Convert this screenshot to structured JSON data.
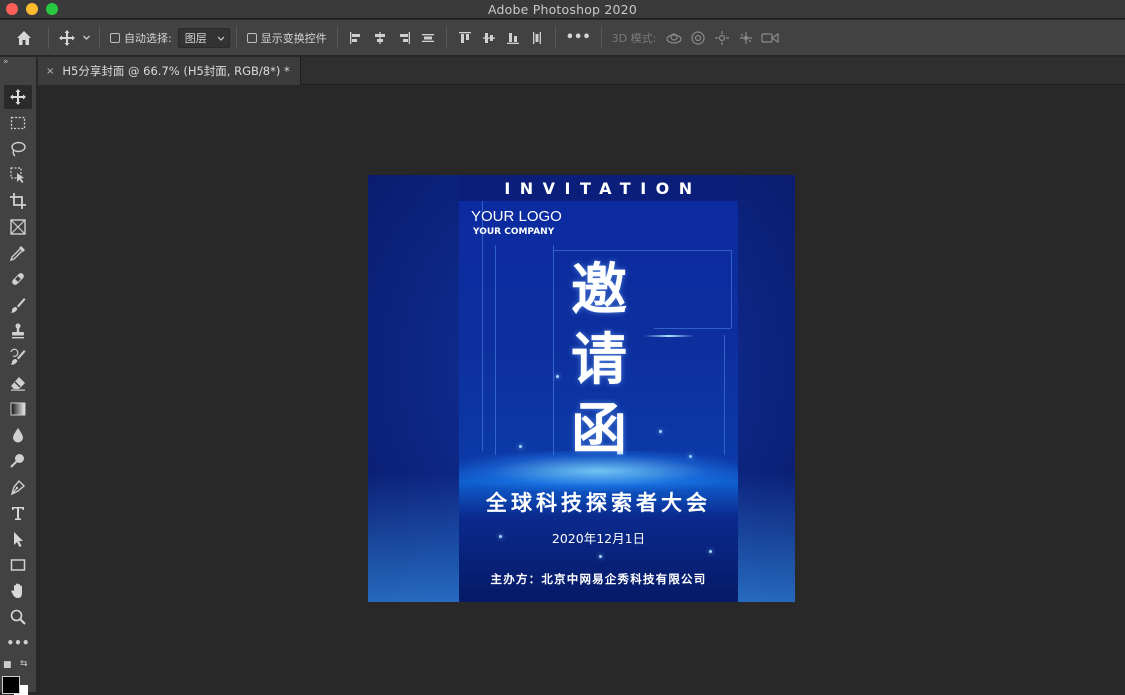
{
  "window": {
    "title": "Adobe Photoshop 2020"
  },
  "options_bar": {
    "auto_select_label": "自动选择:",
    "auto_select_value": "图层",
    "show_transform_label": "显示变换控件",
    "more_label": "•••",
    "mode_3d_label": "3D 模式:"
  },
  "tabs": [
    {
      "label": "H5分享封面 @ 66.7% (H5封面, RGB/8*) *",
      "close": "×"
    }
  ],
  "toolbar": {
    "collapse": "»",
    "more": "•••",
    "tools": [
      "move-tool",
      "marquee-tool",
      "lasso-tool",
      "object-select-tool",
      "crop-tool",
      "frame-tool",
      "eyedropper-tool",
      "healing-brush-tool",
      "brush-tool",
      "clone-stamp-tool",
      "history-brush-tool",
      "eraser-tool",
      "gradient-tool",
      "blur-tool",
      "dodge-tool",
      "pen-tool",
      "type-tool",
      "path-select-tool",
      "rectangle-tool",
      "hand-tool",
      "zoom-tool"
    ],
    "active_tool": "move-tool",
    "foreground_color": "#000000",
    "background_color": "#ffffff"
  },
  "document": {
    "banner": "INVITATION",
    "logo": "YOUR LOGO",
    "company": "YOUR COMPANY",
    "headline_chars": [
      "邀",
      "请",
      "函"
    ],
    "event_title": "全球科技探索者大会",
    "date": "2020年12月1日",
    "host": "主办方：北京中网易企秀科技有限公司"
  },
  "colors": {
    "chrome_dark": "#282828",
    "panel": "#424242",
    "poster_blue": "#0d2f9e",
    "glow_cyan": "#aee3ff"
  }
}
